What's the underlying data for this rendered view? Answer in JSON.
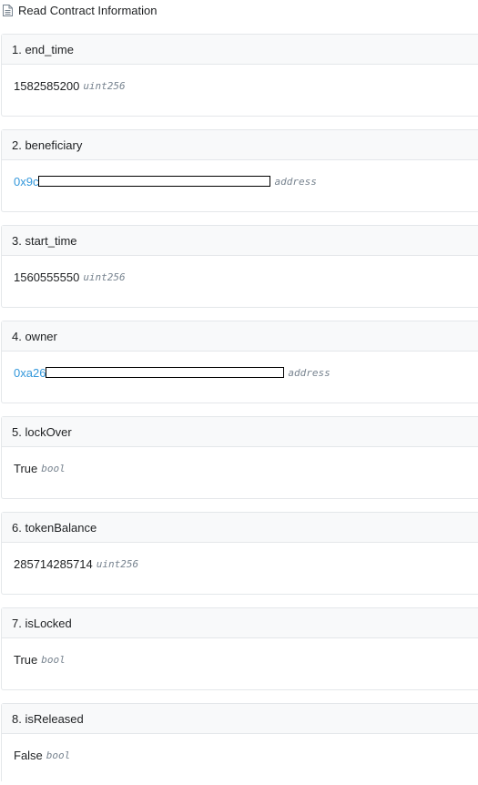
{
  "header": {
    "title": "Read Contract Information",
    "icon": "document-icon"
  },
  "items": [
    {
      "label": "1. end_time",
      "value": "1582585200",
      "type": "uint256",
      "link": false
    },
    {
      "label": "2. beneficiary",
      "value": "0x9c",
      "type": "address",
      "link": true
    },
    {
      "label": "3. start_time",
      "value": "1560555550",
      "type": "uint256",
      "link": false
    },
    {
      "label": "4. owner",
      "value": "0xa26",
      "type": "address",
      "link": true
    },
    {
      "label": "5. lockOver",
      "value": "True",
      "type": "bool",
      "link": false
    },
    {
      "label": "6. tokenBalance",
      "value": "285714285714",
      "type": "uint256",
      "link": false
    },
    {
      "label": "7. isLocked",
      "value": "True",
      "type": "bool",
      "link": false
    },
    {
      "label": "8. isReleased",
      "value": "False",
      "type": "bool",
      "link": false
    }
  ],
  "colors": {
    "link": "#3498db",
    "type": "#77838f",
    "border": "#e4e7ea",
    "header_bg": "#f8f9fa"
  }
}
